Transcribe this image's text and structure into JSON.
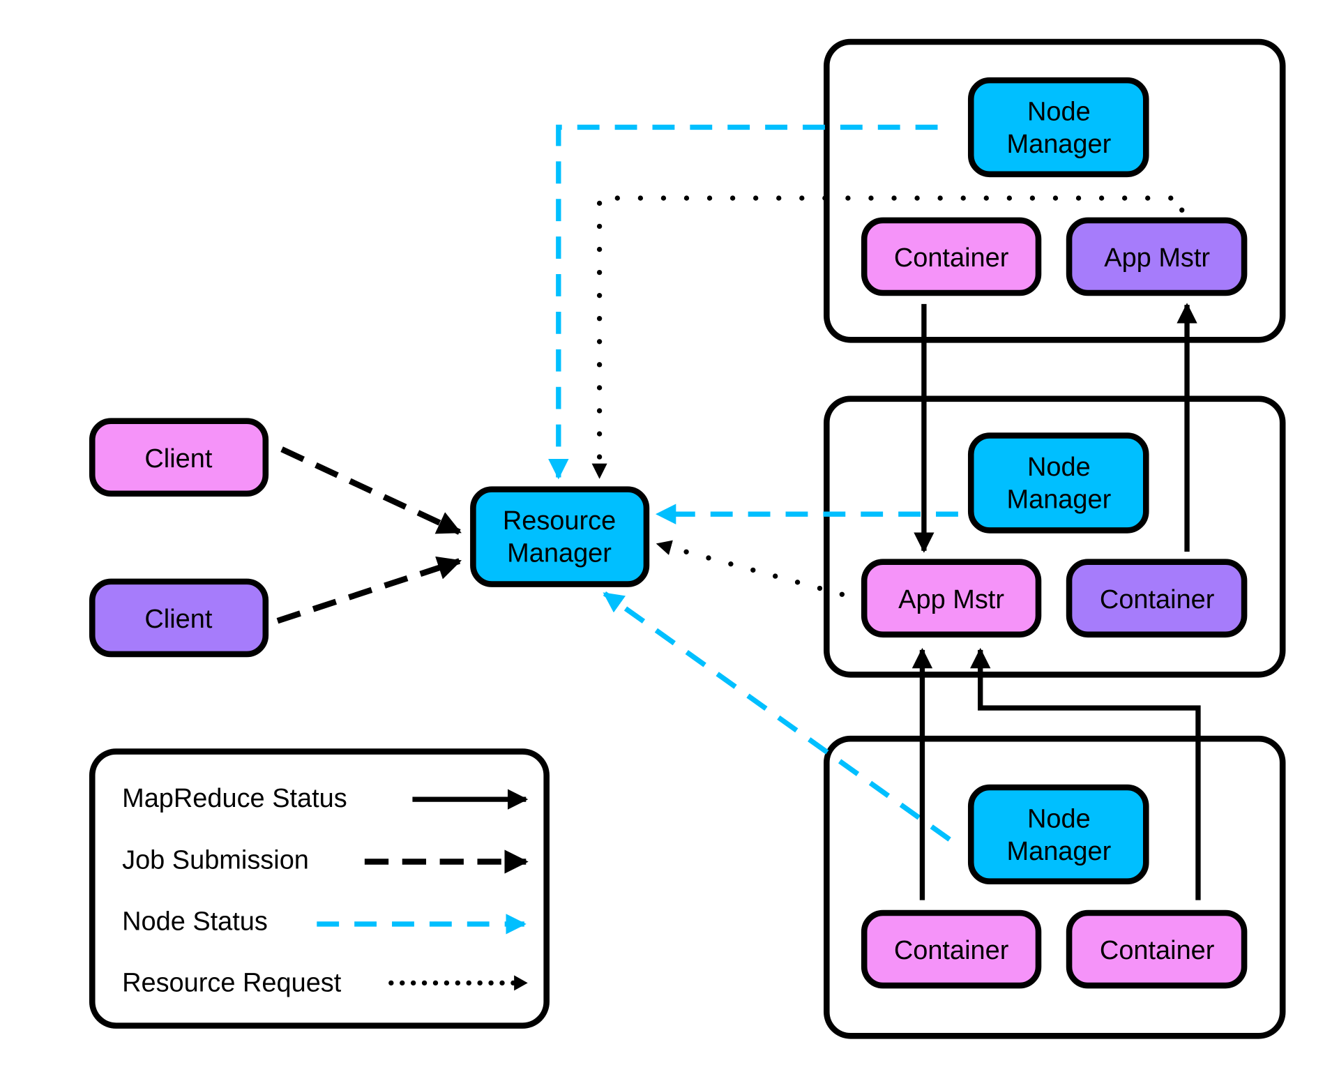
{
  "colors": {
    "node_manager": "#00bfff",
    "pink": "#f593f9",
    "purple": "#a67cfb",
    "status_line": "#00bfff"
  },
  "clients": [
    {
      "label": "Client"
    },
    {
      "label": "Client"
    }
  ],
  "resource_manager": {
    "line1": "Resource",
    "line2": "Manager"
  },
  "nodes": [
    {
      "manager_line1": "Node",
      "manager_line2": "Manager",
      "left": "Container",
      "right": "App Mstr"
    },
    {
      "manager_line1": "Node",
      "manager_line2": "Manager",
      "left": "App Mstr",
      "right": "Container"
    },
    {
      "manager_line1": "Node",
      "manager_line2": "Manager",
      "left": "Container",
      "right": "Container"
    }
  ],
  "legend": [
    {
      "label": "MapReduce Status",
      "style": "solid"
    },
    {
      "label": "Job Submission",
      "style": "dashed"
    },
    {
      "label": "Node Status",
      "style": "cyan-dashed"
    },
    {
      "label": "Resource Request",
      "style": "dotted"
    }
  ]
}
